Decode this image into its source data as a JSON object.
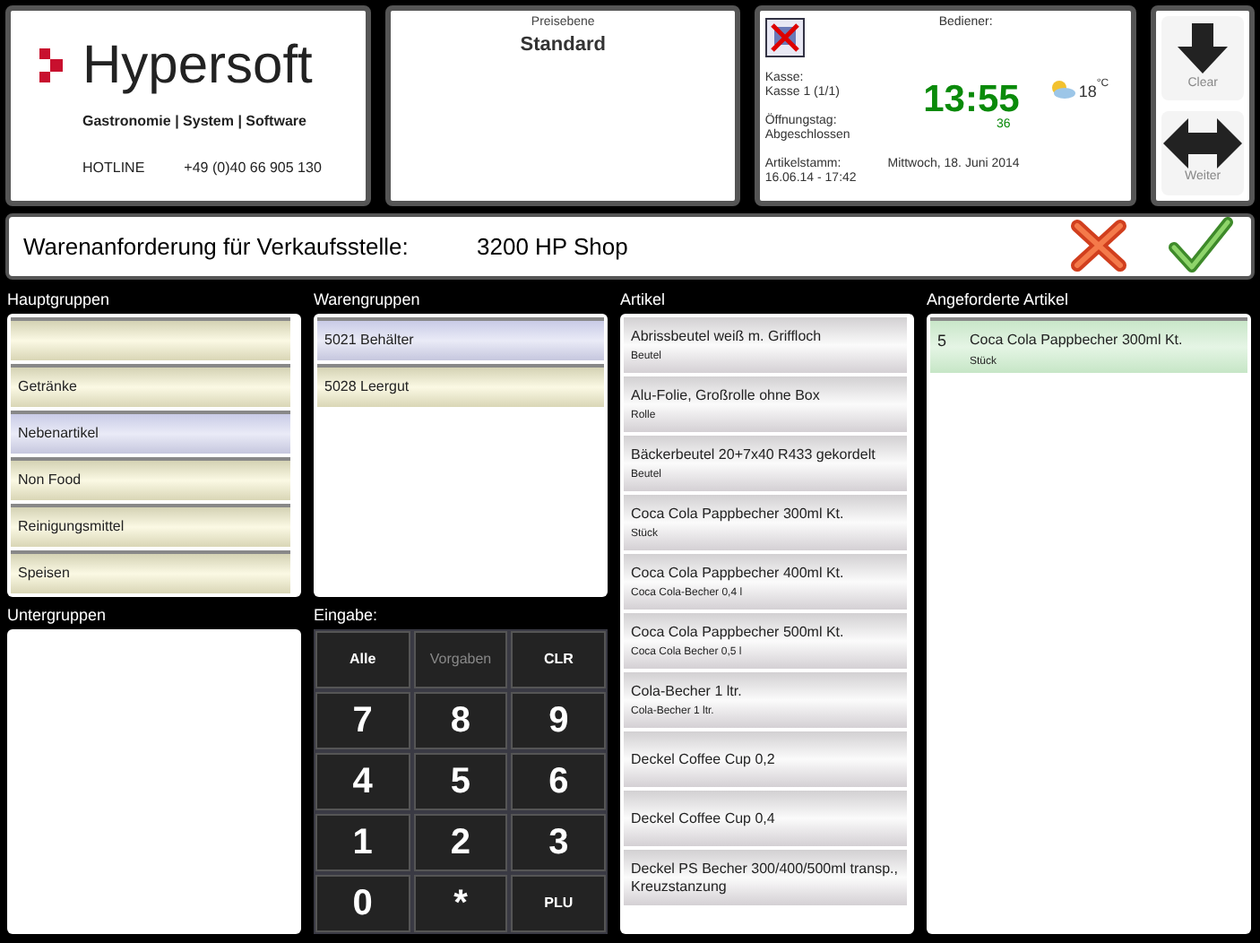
{
  "logo": {
    "name": "Hypersoft",
    "tagline": "Gastronomie | System | Software",
    "hotline_label": "HOTLINE",
    "hotline_number": "+49 (0)40 66 905 130"
  },
  "price_level": {
    "label": "Preisebene",
    "value": "Standard"
  },
  "info": {
    "operator_label": "Bediener:",
    "register_label": "Kasse:",
    "register": "Kasse 1 (1/1)",
    "opening_label": "Öffnungstag:",
    "opening": "Abgeschlossen",
    "master_label": "Artikelstamm:",
    "master": "16.06.14 - 17:42",
    "time": "13:55",
    "seconds": "36",
    "date": "Mittwoch, 18. Juni 2014",
    "temperature": "18",
    "unit": "°C"
  },
  "side_buttons": [
    {
      "label": "Clear",
      "kind": "down"
    },
    {
      "label": "Weiter",
      "kind": "both"
    }
  ],
  "title": {
    "label": "Warenanforderung für Verkaufsstelle:",
    "store": "3200 HP Shop"
  },
  "main_groups": {
    "heading": "Hauptgruppen",
    "items": [
      {
        "selected": false
      },
      {
        "label": "Getränke",
        "selected": false
      },
      {
        "label": "Nebenartikel",
        "selected": true
      },
      {
        "label": "Non Food",
        "selected": false
      },
      {
        "label": "Reinigungsmittel",
        "selected": false
      },
      {
        "label": "Speisen",
        "selected": false
      }
    ]
  },
  "goods_groups": {
    "heading": "Warengruppen",
    "items": [
      {
        "label": "5021 Behälter",
        "selected": true
      },
      {
        "label": "5028 Leergut",
        "selected": false
      }
    ]
  },
  "sub_groups": {
    "heading": "Untergruppen"
  },
  "input": {
    "heading": "Eingabe:",
    "keys": [
      {
        "label": "Alle",
        "kind": "text",
        "disabled": false
      },
      {
        "label": "Vorgaben",
        "kind": "text",
        "disabled": true
      },
      {
        "label": "CLR",
        "kind": "text",
        "disabled": false
      },
      {
        "label": "7",
        "kind": "digit",
        "disabled": false
      },
      {
        "label": "8",
        "kind": "digit",
        "disabled": false
      },
      {
        "label": "9",
        "kind": "digit",
        "disabled": false
      },
      {
        "label": "4",
        "kind": "digit",
        "disabled": false
      },
      {
        "label": "5",
        "kind": "digit",
        "disabled": false
      },
      {
        "label": "6",
        "kind": "digit",
        "disabled": false
      },
      {
        "label": "1",
        "kind": "digit",
        "disabled": false
      },
      {
        "label": "2",
        "kind": "digit",
        "disabled": false
      },
      {
        "label": "3",
        "kind": "digit",
        "disabled": false
      },
      {
        "label": "0",
        "kind": "digit",
        "disabled": false
      },
      {
        "label": "*",
        "kind": "digit",
        "disabled": false
      },
      {
        "label": "PLU",
        "kind": "text",
        "disabled": false
      }
    ]
  },
  "articles": {
    "heading": "Artikel",
    "items": [
      {
        "name": "Abrissbeutel weiß m. Griffloch",
        "unit": "Beutel"
      },
      {
        "name": "Alu-Folie, Großrolle ohne Box",
        "unit": "Rolle"
      },
      {
        "name": "Bäckerbeutel 20+7x40 R433 gekordelt",
        "unit": "Beutel"
      },
      {
        "name": "Coca Cola Pappbecher 300ml Kt.",
        "unit": "Stück"
      },
      {
        "name": "Coca Cola Pappbecher 400ml Kt.",
        "unit": "Coca Cola-Becher  0,4 l"
      },
      {
        "name": "Coca Cola Pappbecher 500ml Kt.",
        "unit": "Coca Cola Becher 0,5 l"
      },
      {
        "name": "Cola-Becher 1 ltr.",
        "unit": "Cola-Becher 1 ltr."
      },
      {
        "name": "Deckel Coffee Cup 0,2"
      },
      {
        "name": "Deckel Coffee Cup 0,4"
      },
      {
        "name": "Deckel PS Becher 300/400/500ml transp., Kreuzstanzung"
      }
    ]
  },
  "requested": {
    "heading": "Angeforderte Artikel",
    "items": [
      {
        "quantity": "5",
        "name": "Coca Cola Pappbecher 300ml Kt.",
        "unit": "Stück"
      }
    ]
  }
}
